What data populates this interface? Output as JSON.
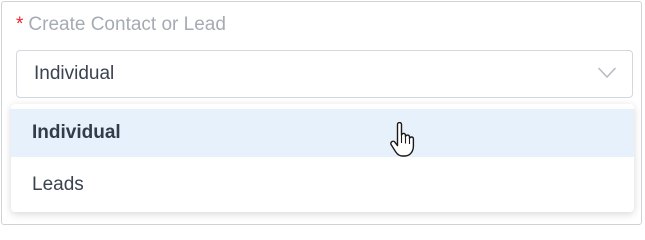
{
  "field": {
    "required_mark": "*",
    "label": "Create Contact or Lead",
    "selected_value": "Individual",
    "chevron_icon": "chevron-down-icon"
  },
  "dropdown": {
    "options": [
      {
        "label": "Individual",
        "selected": true
      },
      {
        "label": "Leads",
        "selected": false
      }
    ]
  },
  "cursor": {
    "icon": "hand-pointer-icon"
  },
  "colors": {
    "required": "#f5222d",
    "label": "#a6abb3",
    "text": "#3b4250",
    "selected_bg": "#e6f1fb",
    "border": "#d4d8de"
  }
}
